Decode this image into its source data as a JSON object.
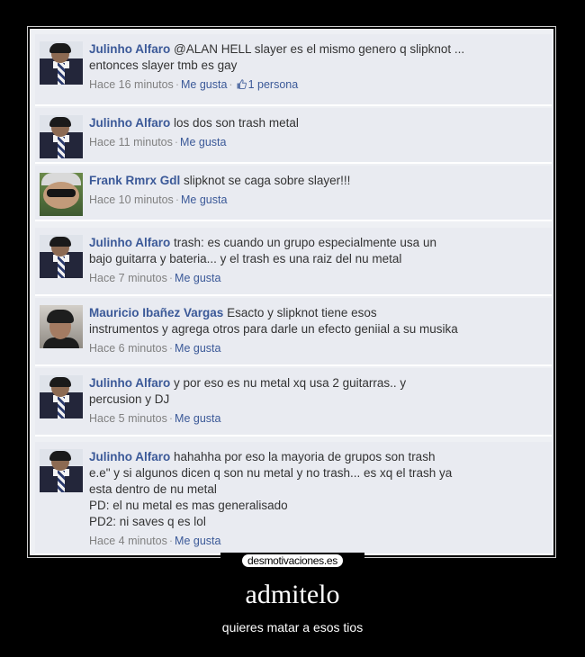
{
  "comments": [
    {
      "author": "Julinho Alfaro",
      "avatar": "julinho-avatar",
      "lines": [
        "@ALAN HELL slayer es el mismo genero q slipknot ...",
        "entonces slayer tmb es gay"
      ],
      "time": "Hace 16 minutos",
      "like_label": "Me gusta",
      "likes": "1 persona"
    },
    {
      "author": "Julinho Alfaro",
      "avatar": "julinho-avatar",
      "lines": [
        "los dos son trash metal"
      ],
      "time": "Hace 11 minutos",
      "like_label": "Me gusta"
    },
    {
      "author": "Frank Rmrx Gdl",
      "avatar": "frank-avatar",
      "lines": [
        "slipknot se caga sobre slayer!!!"
      ],
      "time": "Hace 10 minutos",
      "like_label": "Me gusta"
    },
    {
      "author": "Julinho Alfaro",
      "avatar": "julinho-avatar",
      "lines": [
        "trash: es cuando un grupo especialmente usa un",
        "bajo guitarra y bateria... y el trash es una raiz del nu metal"
      ],
      "time": "Hace 7 minutos",
      "like_label": "Me gusta"
    },
    {
      "author": "Mauricio Ibañez Vargas",
      "avatar": "mauricio-avatar",
      "lines": [
        "Esacto y slipknot tiene esos",
        "instrumentos y agrega otros para darle un efecto geniial a su musika"
      ],
      "time": "Hace 6 minutos",
      "like_label": "Me gusta"
    },
    {
      "author": "Julinho Alfaro",
      "avatar": "julinho-avatar",
      "lines": [
        "y por eso es nu metal xq usa 2 guitarras.. y",
        "percusion y DJ"
      ],
      "time": "Hace 5 minutos",
      "like_label": "Me gusta"
    },
    {
      "author": "Julinho Alfaro",
      "avatar": "julinho-avatar",
      "lines": [
        "hahahha por eso la mayoria de grupos son trash",
        "e.e\" y si algunos dicen q son nu metal y no trash... es xq el trash ya",
        "esta dentro de nu metal",
        "PD: el nu metal es mas generalisado",
        "PD2: ni saves q es lol"
      ],
      "time": "Hace 4 minutos",
      "like_label": "Me gusta"
    }
  ],
  "watermark": "desmotivaciones.es",
  "title": "admitelo",
  "subtitle": "quieres matar a esos tios",
  "colors": {
    "author": "#3b5998",
    "meta": "#808080",
    "card": "#e9ebf1",
    "background": "#000000"
  }
}
